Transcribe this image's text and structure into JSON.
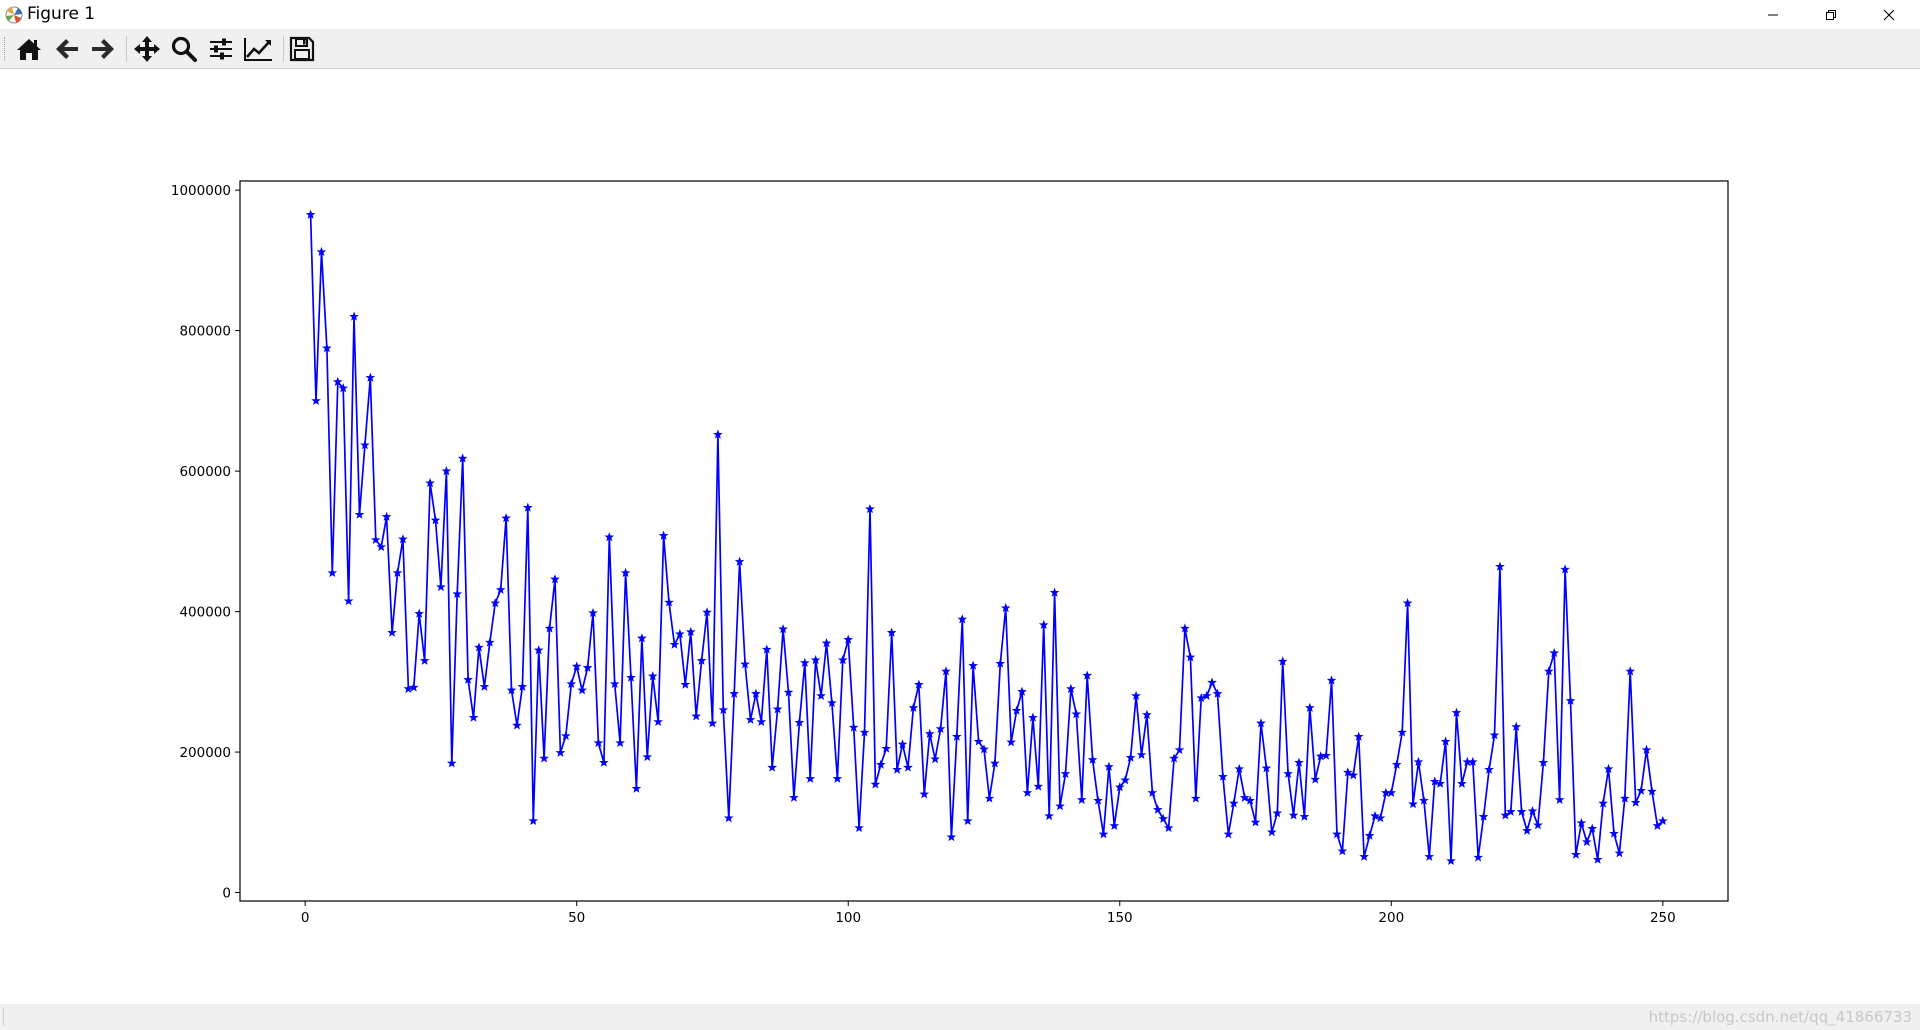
{
  "window": {
    "title": "Figure 1",
    "buttons": {
      "minimize": "minimize-icon",
      "maximize": "restore-icon",
      "close": "close-icon"
    }
  },
  "toolbar": {
    "tools": [
      {
        "name": "home",
        "icon": "home-icon"
      },
      {
        "name": "back",
        "icon": "arrow-left-icon"
      },
      {
        "name": "forward",
        "icon": "arrow-right-icon"
      },
      {
        "name": "pan",
        "icon": "move-icon"
      },
      {
        "name": "zoom",
        "icon": "magnifier-icon"
      },
      {
        "name": "subplots",
        "icon": "sliders-icon"
      },
      {
        "name": "edit-axes",
        "icon": "line-chart-icon"
      },
      {
        "name": "save",
        "icon": "floppy-disk-icon"
      }
    ]
  },
  "statusbar": {
    "watermark": "https://blog.csdn.net/qq_41866733"
  },
  "colors": {
    "series": "#0000ff",
    "toolbar_bg": "#f0f0f0",
    "axes": "#000000"
  },
  "chart_data": {
    "type": "line",
    "marker": "star",
    "title": "",
    "xlabel": "",
    "ylabel": "",
    "xlim": [
      -12,
      262
    ],
    "ylim": [
      -12000,
      1013000
    ],
    "xticks": [
      0,
      50,
      100,
      150,
      200,
      250
    ],
    "xtick_labels": [
      "0",
      "50",
      "100",
      "150",
      "200",
      "250"
    ],
    "yticks": [
      0,
      200000,
      400000,
      600000,
      800000,
      1000000
    ],
    "ytick_labels": [
      "0",
      "200000",
      "400000",
      "600000",
      "800000",
      "1000000"
    ],
    "grid": false,
    "series": [
      {
        "color": "#0000ff",
        "x": [
          1,
          2,
          3,
          4,
          5,
          6,
          7,
          8,
          9,
          10,
          11,
          12,
          13,
          14,
          15,
          16,
          17,
          18,
          19,
          20,
          21,
          22,
          23,
          24,
          25,
          26,
          27,
          28,
          29,
          30,
          31,
          32,
          33,
          34,
          35,
          36,
          37,
          38,
          39,
          40,
          41,
          42,
          43,
          44,
          45,
          46,
          47,
          48,
          49,
          50,
          51,
          52,
          53,
          54,
          55,
          56,
          57,
          58,
          59,
          60,
          61,
          62,
          63,
          64,
          65,
          66,
          67,
          68,
          69,
          70,
          71,
          72,
          73,
          74,
          75,
          76,
          77,
          78,
          79,
          80,
          81,
          82,
          83,
          84,
          85,
          86,
          87,
          88,
          89,
          90,
          91,
          92,
          93,
          94,
          95,
          96,
          97,
          98,
          99,
          100,
          101,
          102,
          103,
          104,
          105,
          106,
          107,
          108,
          109,
          110,
          111,
          112,
          113,
          114,
          115,
          116,
          117,
          118,
          119,
          120,
          121,
          122,
          123,
          124,
          125,
          126,
          127,
          128,
          129,
          130,
          131,
          132,
          133,
          134,
          135,
          136,
          137,
          138,
          139,
          140,
          141,
          142,
          143,
          144,
          145,
          146,
          147,
          148,
          149,
          150,
          151,
          152,
          153,
          154,
          155,
          156,
          157,
          158,
          159,
          160,
          161,
          162,
          163,
          164,
          165,
          166,
          167,
          168,
          169,
          170,
          171,
          172,
          173,
          174,
          175,
          176,
          177,
          178,
          179,
          180,
          181,
          182,
          183,
          184,
          185,
          186,
          187,
          188,
          189,
          190,
          191,
          192,
          193,
          194,
          195,
          196,
          197,
          198,
          199,
          200,
          201,
          202,
          203,
          204,
          205,
          206,
          207,
          208,
          209,
          210,
          211,
          212,
          213,
          214,
          215,
          216,
          217,
          218,
          219,
          220,
          221,
          222,
          223,
          224,
          225,
          226,
          227,
          228,
          229,
          230,
          231,
          232,
          233,
          234,
          235,
          236,
          237,
          238,
          239,
          240,
          241,
          242,
          243,
          244,
          245,
          246,
          247,
          248,
          249,
          250
        ],
        "y": [
          965000,
          700000,
          912000,
          775000,
          455000,
          727000,
          718000,
          415000,
          820000,
          538000,
          637000,
          733000,
          502000,
          492000,
          535000,
          370000,
          455000,
          503000,
          290000,
          292000,
          397000,
          330000,
          583000,
          530000,
          435000,
          600000,
          184000,
          425000,
          618000,
          303000,
          249000,
          349000,
          293000,
          356000,
          412000,
          431000,
          533000,
          288000,
          238000,
          293000,
          548000,
          102000,
          345000,
          191000,
          376000,
          446000,
          199000,
          223000,
          297000,
          322000,
          288000,
          320000,
          398000,
          213000,
          185000,
          506000,
          297000,
          213000,
          455000,
          306000,
          148000,
          362000,
          193000,
          308000,
          243000,
          508000,
          413000,
          353000,
          368000,
          296000,
          371000,
          251000,
          330000,
          399000,
          241000,
          652000,
          260000,
          106000,
          283000,
          471000,
          325000,
          246000,
          283000,
          243000,
          346000,
          178000,
          261000,
          375000,
          285000,
          135000,
          242000,
          327000,
          162000,
          331000,
          280000,
          355000,
          270000,
          162000,
          331000,
          360000,
          235000,
          92000,
          228000,
          546000,
          154000,
          182000,
          205000,
          370000,
          175000,
          211000,
          178000,
          263000,
          296000,
          140000,
          226000,
          190000,
          233000,
          315000,
          79000,
          222000,
          389000,
          102000,
          323000,
          215000,
          204000,
          134000,
          184000,
          326000,
          405000,
          214000,
          259000,
          286000,
          142000,
          249000,
          151000,
          381000,
          109000,
          427000,
          123000,
          169000,
          290000,
          254000,
          132000,
          309000,
          189000,
          131000,
          83000,
          179000,
          95000,
          150000,
          160000,
          192000,
          280000,
          196000,
          253000,
          142000,
          118000,
          105000,
          92000,
          191000,
          203000,
          376000,
          335000,
          134000,
          277000,
          280000,
          299000,
          283000,
          165000,
          83000,
          127000,
          176000,
          135000,
          131000,
          100000,
          241000,
          177000,
          86000,
          113000,
          329000,
          169000,
          110000,
          185000,
          108000,
          263000,
          161000,
          194000,
          195000,
          302000,
          83000,
          59000,
          171000,
          167000,
          222000,
          51000,
          81000,
          109000,
          106000,
          142000,
          142000,
          182000,
          228000,
          412000,
          126000,
          186000,
          131000,
          51000,
          158000,
          155000,
          215000,
          45000,
          256000,
          155000,
          186000,
          186000,
          50000,
          108000,
          175000,
          224000,
          464000,
          110000,
          115000,
          236000,
          115000,
          88000,
          116000,
          96000,
          185000,
          315000,
          341000,
          132000,
          460000,
          273000,
          54000,
          99000,
          72000,
          91000,
          47000,
          127000,
          176000,
          84000,
          56000,
          134000,
          315000,
          128000,
          145000,
          203000,
          144000,
          95000,
          102000
        ]
      }
    ]
  }
}
